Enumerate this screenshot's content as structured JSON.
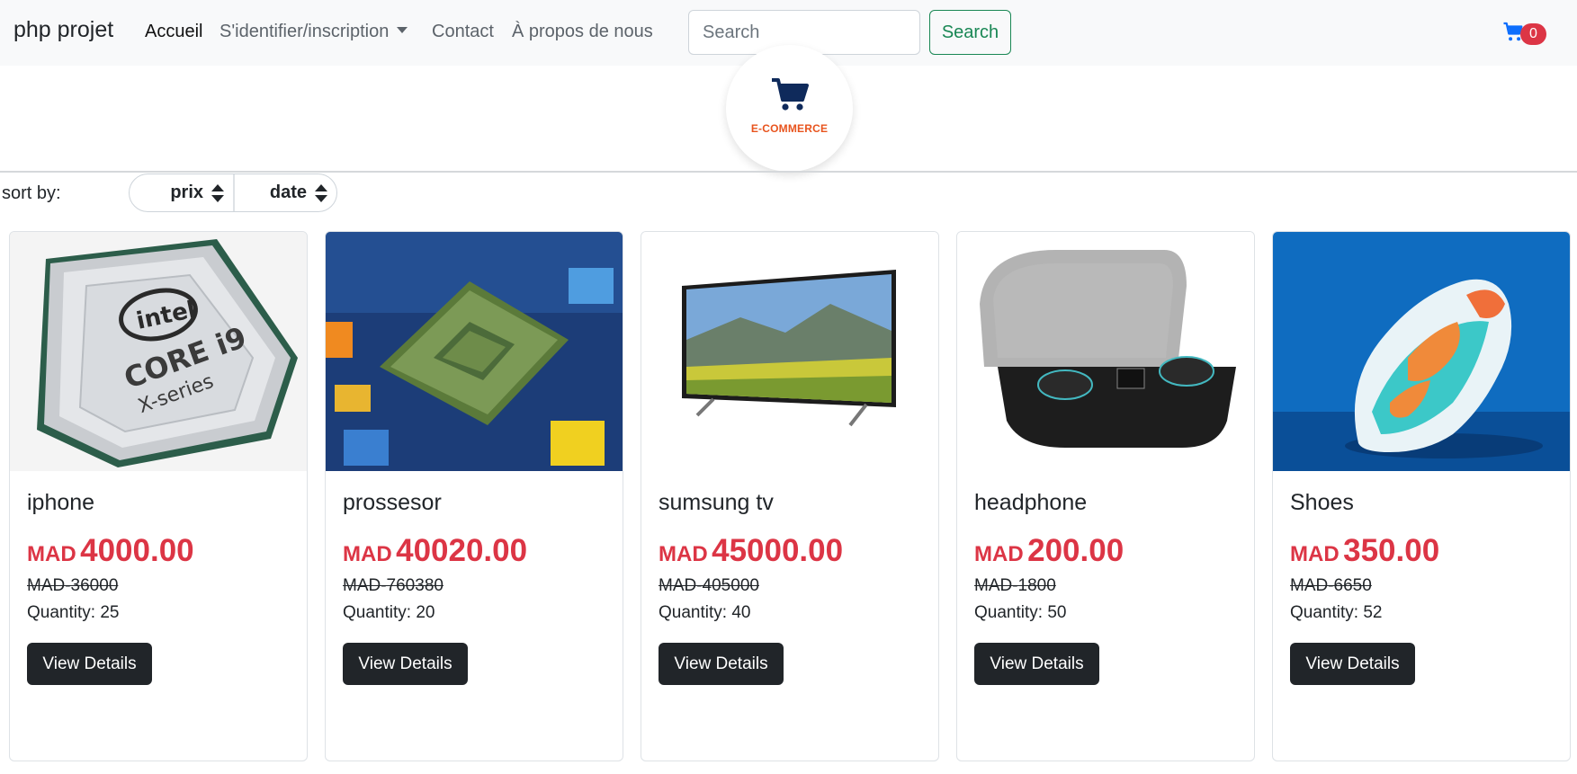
{
  "navbar": {
    "brand": "php projet",
    "links": [
      {
        "label": "Accueil",
        "active": true
      },
      {
        "label": "S'identifier/inscription",
        "dropdown": true
      },
      {
        "label": "Contact"
      },
      {
        "label": "À propos de nous"
      }
    ],
    "search": {
      "placeholder": "Search",
      "value": "",
      "button_label": "Search"
    },
    "cart": {
      "icon": "cart-icon",
      "count": "0"
    }
  },
  "logo": {
    "icon": "shopping-cart-icon",
    "text": "E-COMMERCE"
  },
  "sort": {
    "label": "sort by:",
    "options": [
      {
        "label": "prix"
      },
      {
        "label": "date"
      }
    ]
  },
  "products": [
    {
      "name": "iphone",
      "currency": "MAD",
      "price": "4000.00",
      "old_price": "MAD-36000",
      "quantity": "Quantity: 25",
      "button": "View Details",
      "image": "intel-core-i9-chip"
    },
    {
      "name": "prossesor",
      "currency": "MAD",
      "price": "40020.00",
      "old_price": "MAD-760380",
      "quantity": "Quantity: 20",
      "button": "View Details",
      "image": "processor-on-circuit-board"
    },
    {
      "name": "sumsung tv",
      "currency": "MAD",
      "price": "45000.00",
      "old_price": "MAD-405000",
      "quantity": "Quantity: 40",
      "button": "View Details",
      "image": "flat-screen-tv"
    },
    {
      "name": "headphone",
      "currency": "MAD",
      "price": "200.00",
      "old_price": "MAD-1800",
      "quantity": "Quantity: 50",
      "button": "View Details",
      "image": "wireless-earbuds-case"
    },
    {
      "name": "Shoes",
      "currency": "MAD",
      "price": "350.00",
      "old_price": "MAD-6650",
      "quantity": "Quantity: 52",
      "button": "View Details",
      "image": "sneaker"
    }
  ],
  "colors": {
    "accent": "#dc3545",
    "success": "#198754",
    "dark": "#212529",
    "logo_text": "#e8541e",
    "cart_icon": "#0d6efd"
  }
}
